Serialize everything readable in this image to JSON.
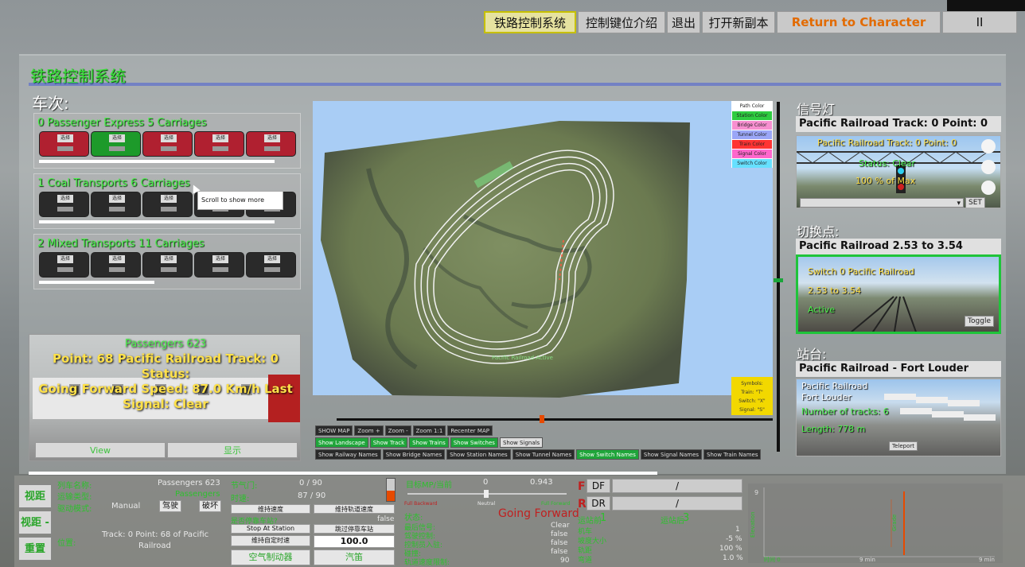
{
  "top_menu": {
    "items": [
      "铁路控制系统",
      "控制键位介绍",
      "退出",
      "打开新副本",
      "Return to Character",
      "II"
    ]
  },
  "main": {
    "title": "铁路控制系统",
    "trains_label": "车次:",
    "trains": [
      {
        "title": "0 Passenger Express  5 Carriages",
        "progress": 0.92
      },
      {
        "title": "1 Coal Transports  6 Carriages",
        "progress": 0.92
      },
      {
        "title": "2 Mixed Transports  11 Carriages",
        "progress": 0.45
      }
    ],
    "car_label": "选择",
    "tooltip": "Scroll to show more"
  },
  "camera": {
    "line1": "Passengers 623",
    "line2": "Point: 68 Pacific Railroad Track: 0 Status:",
    "line3": "Going Forward Speed: 87.0  Km/h Last",
    "line4": "Signal: Clear",
    "view_btn": "View",
    "show_btn": "显示"
  },
  "map": {
    "legend": [
      "Path Color",
      "Station Color",
      "Bridge Color",
      "Tunnel Color",
      "Train Color",
      "Signal Color",
      "Switch Color"
    ],
    "legend_colors": [
      "#ffffff",
      "#2ecc40",
      "#f78fd0",
      "#9aa6f7",
      "#ff3333",
      "#ff66cc",
      "#66e0ff"
    ],
    "symbols": [
      "Symbols:",
      "Train: \"T\"",
      "Switch: \"X\"",
      "Signal: \"S\""
    ],
    "track_label": "Pacific Railroad Active",
    "row1": [
      "SHOW MAP",
      "Zoom +",
      "Zoom -",
      "Zoom 1:1",
      "Recenter MAP"
    ],
    "row2": [
      "Show Landscape",
      "Show Track",
      "Show Trains",
      "Show Switches",
      "Show Signals"
    ],
    "row3": [
      "Show Railway Names",
      "Show Bridge Names",
      "Show Station Names",
      "Show Tunnel Names",
      "Show Switch Names",
      "Show Signal Names",
      "Show Train Names"
    ],
    "slider_position": 0.47
  },
  "signal": {
    "head": "信号灯",
    "sub": "Pacific Railroad Track: 0 Point: 0",
    "ov1": "Pacific Railroad Track: 0 Point: 0",
    "ov2": "Status: Clear",
    "ov3": "100 % of Max",
    "set_btn": "SET"
  },
  "switch": {
    "head": "切换点:",
    "sub": "Pacific Railroad 2.53 to 3.54",
    "ov1": "Switch 0 Pacific Railroad",
    "ov2": "2.53 to 3.54",
    "ov3": "Active",
    "toggle": "Toggle"
  },
  "station": {
    "head": "站台:",
    "sub": "Pacific Railroad - Fort Louder",
    "ov1": "Pacific Railroad",
    "ov2": "Fort Louder",
    "ov3": "Number of tracks: 6",
    "ov4": "Length: 778 m",
    "teleport": "Teleport"
  },
  "bottom": {
    "side_buttons": [
      "视距 +",
      "视距 -",
      "重置"
    ],
    "train_name_label": "列车名称:",
    "train_name_value": "Passengers 623",
    "type_label": "运输类型:",
    "type_value": "Passengers",
    "drive_label": "驱动模式:",
    "drive_value": "Manual",
    "drive_btn1": "驾驶",
    "drive_btn2": "破坏",
    "pos_label": "位置:",
    "pos_value1": "Track: 0 Point: 68 of Pacific",
    "pos_value2": "Railroad",
    "throttle_label": "节气门:",
    "throttle_value": "0  /  90",
    "speed_label": "时速:",
    "speed_value": "87  /  90",
    "btn_a": "维持速度",
    "btn_b": "维持轨道速度",
    "stop_q": "是否停靠车站?",
    "stop_val": "false",
    "stop_btn": "Stop At Station",
    "stop_btn2": "跳过停靠车站",
    "custom_btn": "维持自定时速",
    "custom_val": "100.0",
    "brake_btn": "空气制动器",
    "horn_btn": "汽笛",
    "target_label": "目标MP/当前",
    "target_a": "0",
    "target_b": "0.943",
    "full_back": "Full Backward",
    "neutral": "Neutral",
    "full_fwd": "Full Forward",
    "status_label": "状态:",
    "status_value": "Going Forward",
    "rows": [
      {
        "k": "最后信号:",
        "v": "Clear"
      },
      {
        "k": "驾驶控制:",
        "v": "false"
      },
      {
        "k": "控制员入驻:",
        "v": "false"
      },
      {
        "k": "碰撞:",
        "v": "false"
      },
      {
        "k": "轨道速度限制:",
        "v": "90"
      }
    ],
    "df": "DF",
    "dr": "DR",
    "df_val": "/",
    "dr_val": "/",
    "f": "F",
    "r": "R",
    "stop_front_label": "运站前",
    "stop_front_val": "1",
    "stop_back_label": "运站后",
    "stop_back_val": "3",
    "stat_rows": [
      {
        "k": "机车",
        "v": "1"
      },
      {
        "k": "坡度大小",
        "v": "-5 %"
      },
      {
        "k": "轨距",
        "v": "100 %"
      },
      {
        "k": "弯道",
        "v": "1.0 %"
      }
    ],
    "elevation": "Elevation",
    "grade": "Grade",
    "t_start": "时间 0",
    "t_mid": "9 min",
    "t_end": "9 min",
    "y_top": "9"
  }
}
